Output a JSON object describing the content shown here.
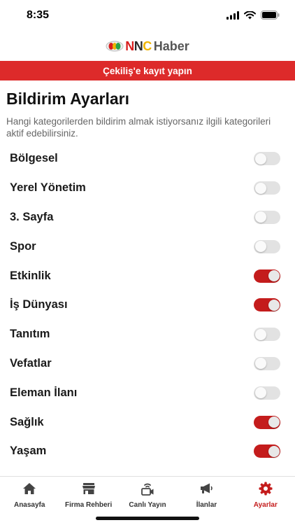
{
  "status": {
    "time": "8:35"
  },
  "logo": {
    "n1": "N",
    "n2": "N",
    "c": "C",
    "haber": "Haber"
  },
  "banner": {
    "text": "Çekiliş'e kayıt yapın"
  },
  "page": {
    "title": "Bildirim Ayarları",
    "description": "Hangi kategorilerden bildirim almak istiyorsanız ilgili kategorileri aktif edebilirsiniz."
  },
  "settings": [
    {
      "label": "Bölgesel",
      "enabled": false
    },
    {
      "label": "Yerel Yönetim",
      "enabled": false
    },
    {
      "label": "3. Sayfa",
      "enabled": false
    },
    {
      "label": "Spor",
      "enabled": false
    },
    {
      "label": "Etkinlik",
      "enabled": true
    },
    {
      "label": "İş Dünyası",
      "enabled": true
    },
    {
      "label": "Tanıtım",
      "enabled": false
    },
    {
      "label": "Vefatlar",
      "enabled": false
    },
    {
      "label": "Eleman İlanı",
      "enabled": false
    },
    {
      "label": "Sağlık",
      "enabled": true
    },
    {
      "label": "Yaşam",
      "enabled": true
    }
  ],
  "tabs": [
    {
      "label": "Anasayfa",
      "icon": "home-icon",
      "active": false
    },
    {
      "label": "Firma Rehberi",
      "icon": "store-icon",
      "active": false
    },
    {
      "label": "Canlı Yayın",
      "icon": "live-camera-icon",
      "active": false
    },
    {
      "label": "İlanlar",
      "icon": "megaphone-icon",
      "active": false
    },
    {
      "label": "Ayarlar",
      "icon": "gear-icon",
      "active": true
    }
  ],
  "colors": {
    "accent": "#c41c1c",
    "banner": "#dd2a2a",
    "toggle_off": "#e2e2e2"
  }
}
